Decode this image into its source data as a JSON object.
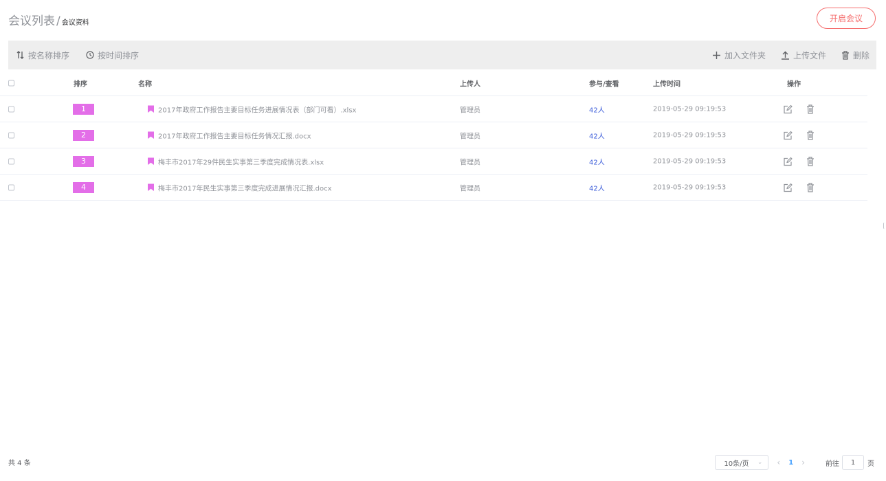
{
  "breadcrumb": {
    "main": "会议列表",
    "separator": "/",
    "sub": "会议资料"
  },
  "start_button": "开启会议",
  "toolbar": {
    "sort_by_name": "按名称排序",
    "sort_by_time": "按时间排序",
    "add_folder": "加入文件夹",
    "upload": "上传文件",
    "delete": "删除"
  },
  "table": {
    "headers": {
      "sort": "排序",
      "name": "名称",
      "uploader": "上传人",
      "views": "参与/查看",
      "time": "上传时间",
      "ops": "操作"
    },
    "rows": [
      {
        "sort": "1",
        "name": "2017年政府工作报告主要目标任务进展情况表（部门可看）.xlsx",
        "uploader": "管理员",
        "views": "42人",
        "time": "2019-05-29 09:19:53"
      },
      {
        "sort": "2",
        "name": "2017年政府工作报告主要目标任务情况汇报.docx",
        "uploader": "管理员",
        "views": "42人",
        "time": "2019-05-29 09:19:53"
      },
      {
        "sort": "3",
        "name": "梅丰市2017年29件民生实事第三季度完成情况表.xlsx",
        "uploader": "管理员",
        "views": "42人",
        "time": "2019-05-29 09:19:53"
      },
      {
        "sort": "4",
        "name": "梅丰市2017年民生实事第三季度完成进展情况汇报.docx",
        "uploader": "管理员",
        "views": "42人",
        "time": "2019-05-29 09:19:53"
      }
    ]
  },
  "footer": {
    "total": "共 4 条",
    "page_size": "10条/页",
    "current_page": "1",
    "goto_label": "前往",
    "goto_value": "1",
    "goto_suffix": "页"
  },
  "colors": {
    "accent": "#f56c6c",
    "badge": "#e36ee8",
    "link": "#3a5bd9",
    "toolbar_bg": "#eeeeee"
  }
}
